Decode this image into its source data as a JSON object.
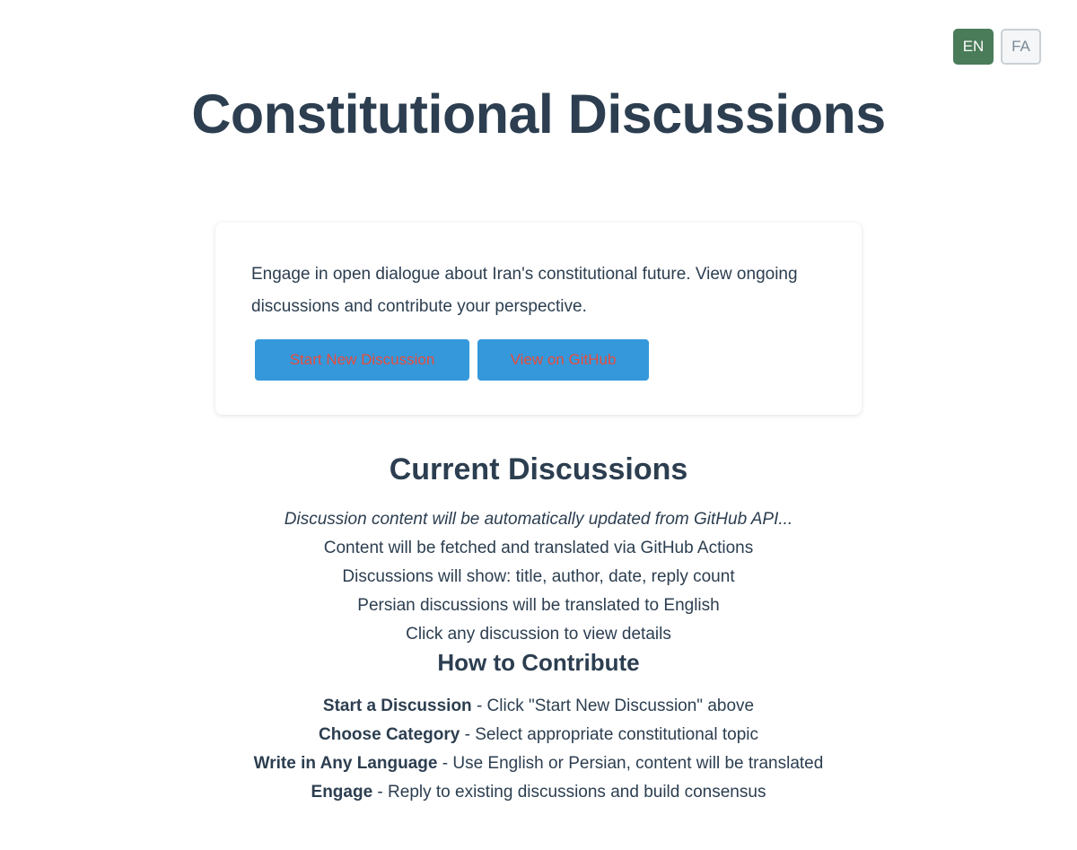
{
  "language_switch": {
    "en_label": "EN",
    "fa_label": "FA"
  },
  "page_title": "Constitutional Discussions",
  "intro": {
    "text": "Engage in open dialogue about Iran's constitutional future. View ongoing discussions and contribute your perspective.",
    "start_button_label": "Start New Discussion",
    "github_button_label": "View on GitHub"
  },
  "current_discussions": {
    "heading": "Current Discussions",
    "status_note": "Discussion content will be automatically updated from GitHub API...",
    "lines": [
      "Content will be fetched and translated via GitHub Actions",
      "Discussions will show: title, author, date, reply count",
      "Persian discussions will be translated to English",
      "Click any discussion to view details"
    ]
  },
  "how_to_contribute": {
    "heading": "How to Contribute",
    "steps": [
      {
        "title": "Start a Discussion",
        "text": " - Click \"Start New Discussion\" above"
      },
      {
        "title": "Choose Category",
        "text": " - Select appropriate constitutional topic"
      },
      {
        "title": "Write in Any Language",
        "text": " - Use English or Persian, content will be translated"
      },
      {
        "title": "Engage",
        "text": " - Reply to existing discussions and build consensus"
      }
    ]
  },
  "colors": {
    "text": "#2c3e50",
    "active_lang": "#4a7c59",
    "button_bg": "#3498db",
    "button_text": "#e74c3c"
  }
}
